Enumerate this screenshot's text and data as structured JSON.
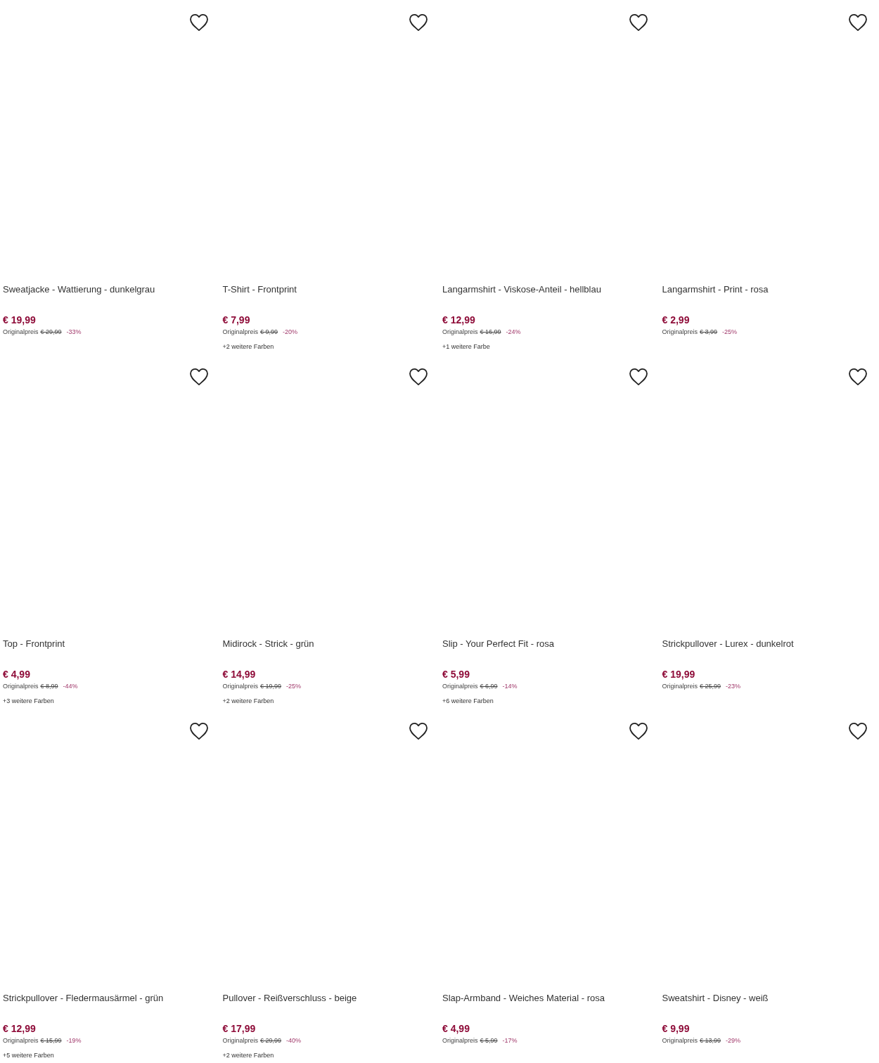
{
  "products": [
    {
      "title": "Sweatjacke - Wattierung - dunkelgrau",
      "price": "€ 19,99",
      "original_label": "Originalpreis",
      "original_price": "€ 29,99",
      "discount": "-33%"
    },
    {
      "title": "T-Shirt - Frontprint",
      "price": "€ 7,99",
      "original_label": "Originalpreis",
      "original_price": "€ 9,99",
      "discount": "-20%",
      "more_colors": "+2 weitere Farben"
    },
    {
      "title": "Langarmshirt - Viskose-Anteil - hellblau",
      "price": "€ 12,99",
      "original_label": "Originalpreis",
      "original_price": "€ 16,99",
      "discount": "-24%",
      "more_colors": "+1 weitere Farbe"
    },
    {
      "title": "Langarmshirt - Print - rosa",
      "price": "€ 2,99",
      "original_label": "Originalpreis",
      "original_price": "€ 3,99",
      "discount": "-25%"
    },
    {
      "title": "Top - Frontprint",
      "price": "€ 4,99",
      "original_label": "Originalpreis",
      "original_price": "€ 8,99",
      "discount": "-44%",
      "more_colors": "+3 weitere Farben"
    },
    {
      "title": "Midirock - Strick - grün",
      "price": "€ 14,99",
      "original_label": "Originalpreis",
      "original_price": "€ 19,99",
      "discount": "-25%",
      "more_colors": "+2 weitere Farben"
    },
    {
      "title": "Slip - Your Perfect Fit - rosa",
      "price": "€ 5,99",
      "original_label": "Originalpreis",
      "original_price": "€ 6,99",
      "discount": "-14%",
      "more_colors": "+6 weitere Farben"
    },
    {
      "title": "Strickpullover - Lurex - dunkelrot",
      "price": "€ 19,99",
      "original_label": "Originalpreis",
      "original_price": "€ 25,99",
      "discount": "-23%"
    },
    {
      "title": "Strickpullover - Fledermausärmel - grün",
      "price": "€ 12,99",
      "original_label": "Originalpreis",
      "original_price": "€ 15,99",
      "discount": "-19%",
      "more_colors": "+5 weitere Farben"
    },
    {
      "title": "Pullover - Reißverschluss - beige",
      "price": "€ 17,99",
      "original_label": "Originalpreis",
      "original_price": "€ 29,99",
      "discount": "-40%",
      "more_colors": "+2 weitere Farben"
    },
    {
      "title": "Slap-Armband - Weiches Material - rosa",
      "price": "€ 4,99",
      "original_label": "Originalpreis",
      "original_price": "€ 5,99",
      "discount": "-17%"
    },
    {
      "title": "Sweatshirt - Disney - weiß",
      "price": "€ 9,99",
      "original_label": "Originalpreis",
      "original_price": "€ 13,99",
      "discount": "-29%"
    }
  ]
}
